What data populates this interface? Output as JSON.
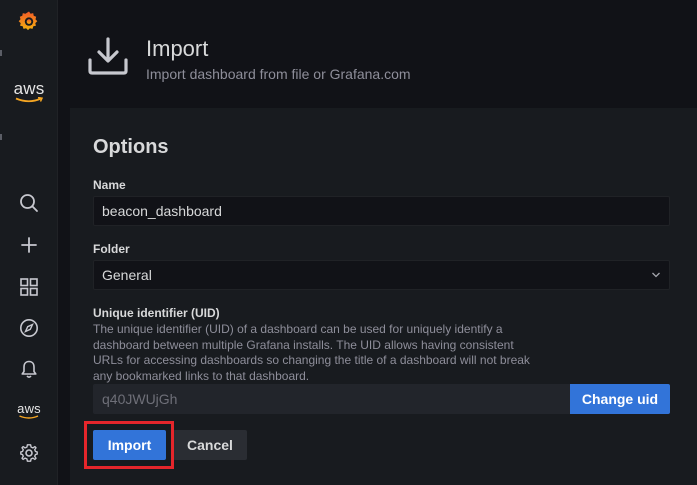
{
  "sidebar": {
    "logo_icon": "grafana-logo-icon",
    "top_plugin_label": "aws",
    "items": [
      {
        "name": "search",
        "icon": "search-icon"
      },
      {
        "name": "create",
        "icon": "plus-icon"
      },
      {
        "name": "dashboards",
        "icon": "dashboards-grid-icon"
      },
      {
        "name": "explore",
        "icon": "compass-icon"
      },
      {
        "name": "alerting",
        "icon": "bell-icon"
      },
      {
        "name": "aws",
        "icon": "aws-icon",
        "label": "aws"
      },
      {
        "name": "configuration",
        "icon": "gear-icon"
      }
    ]
  },
  "header": {
    "icon": "import-icon",
    "title": "Import",
    "subtitle": "Import dashboard from file or Grafana.com"
  },
  "options": {
    "title": "Options",
    "name_label": "Name",
    "name_value": "beacon_dashboard",
    "folder_label": "Folder",
    "folder_value": "General",
    "uid_label": "Unique identifier (UID)",
    "uid_description": "The unique identifier (UID) of a dashboard can be used for uniquely identify a dashboard between multiple Grafana installs. The UID allows having consistent URLs for accessing dashboards so changing the title of a dashboard will not break any bookmarked links to that dashboard.",
    "uid_value": "q40JWUjGh",
    "change_uid_label": "Change uid"
  },
  "actions": {
    "import_label": "Import",
    "cancel_label": "Cancel"
  },
  "colors": {
    "accent": "#3274d9",
    "highlight": "#e5262b",
    "background": "#111217",
    "panel": "#181b1f"
  }
}
